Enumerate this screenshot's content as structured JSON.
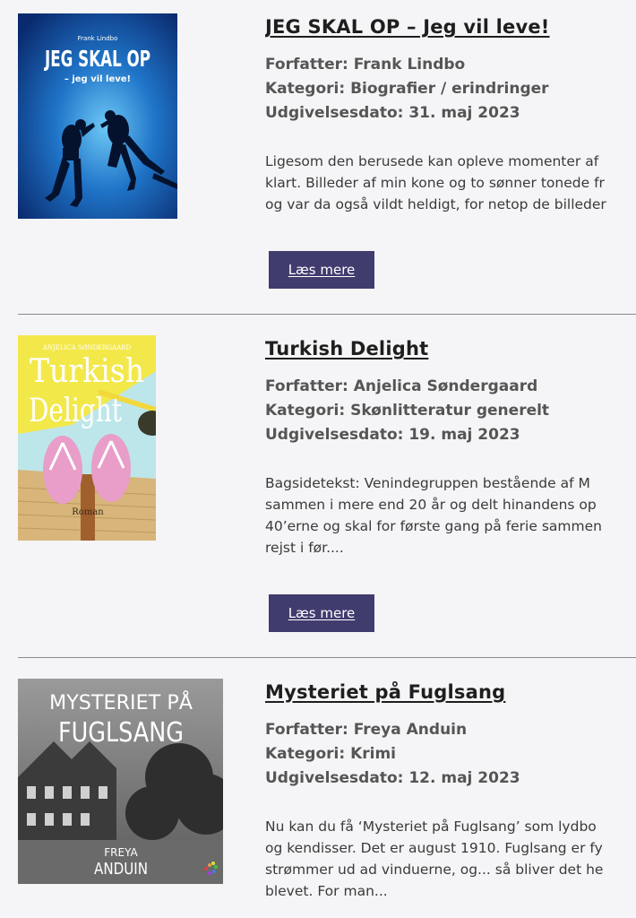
{
  "books": [
    {
      "title": "JEG SKAL OP – Jeg vil leve!",
      "author": "Forfatter: Frank Lindbo",
      "category": "Kategori: Biografier / erindringer",
      "date": "Udgivelsesdato: 31. maj 2023",
      "excerpt": [
        "Ligesom den berusede kan opleve momenter af",
        "klart. Billeder af min kone og to sønner tonede fr",
        "og var da også vildt heldigt, for netop de billeder"
      ],
      "button": "Læs mere",
      "cover": {
        "author": "Frank Lindbo",
        "title": "JEG SKAL OP",
        "subtitle": "– jeg vil leve!"
      }
    },
    {
      "title": "Turkish Delight",
      "author": "Forfatter: Anjelica Søndergaard",
      "category": "Kategori: Skønlitteratur generelt",
      "date": "Udgivelsesdato: 19. maj 2023",
      "excerpt": [
        "Bagsidetekst: Venindegruppen bestående af M",
        "sammen i mere end 20 år og delt hinandens op",
        "40’erne og skal for første gang på ferie sammen",
        "rejst i før...."
      ],
      "button": "Læs mere",
      "cover": {
        "author": "ANJELICA SØNDERGAARD",
        "title1": "Turkish",
        "title2": "Delight",
        "genre": "Roman"
      }
    },
    {
      "title": "Mysteriet på Fuglsang",
      "author": "Forfatter: Freya Anduin",
      "category": "Kategori: Krimi",
      "date": "Udgivelsesdato: 12. maj 2023",
      "excerpt": [
        "Nu kan du få ‘Mysteriet på Fuglsang’ som lydbo",
        "og kendisser. Det er august 1910. Fuglsang er fy",
        "strømmer ud ad vinduerne, og... så bliver det he",
        "blevet. For man..."
      ],
      "cover": {
        "title1": "MYSTERIET PÅ",
        "title2": "FUGLSANG",
        "author1": "FREYA",
        "author2": "ANDUIN"
      }
    }
  ],
  "colors": {
    "button": "#403c6e",
    "divider": "#8a8a8a",
    "background": "#f5f5f7"
  }
}
